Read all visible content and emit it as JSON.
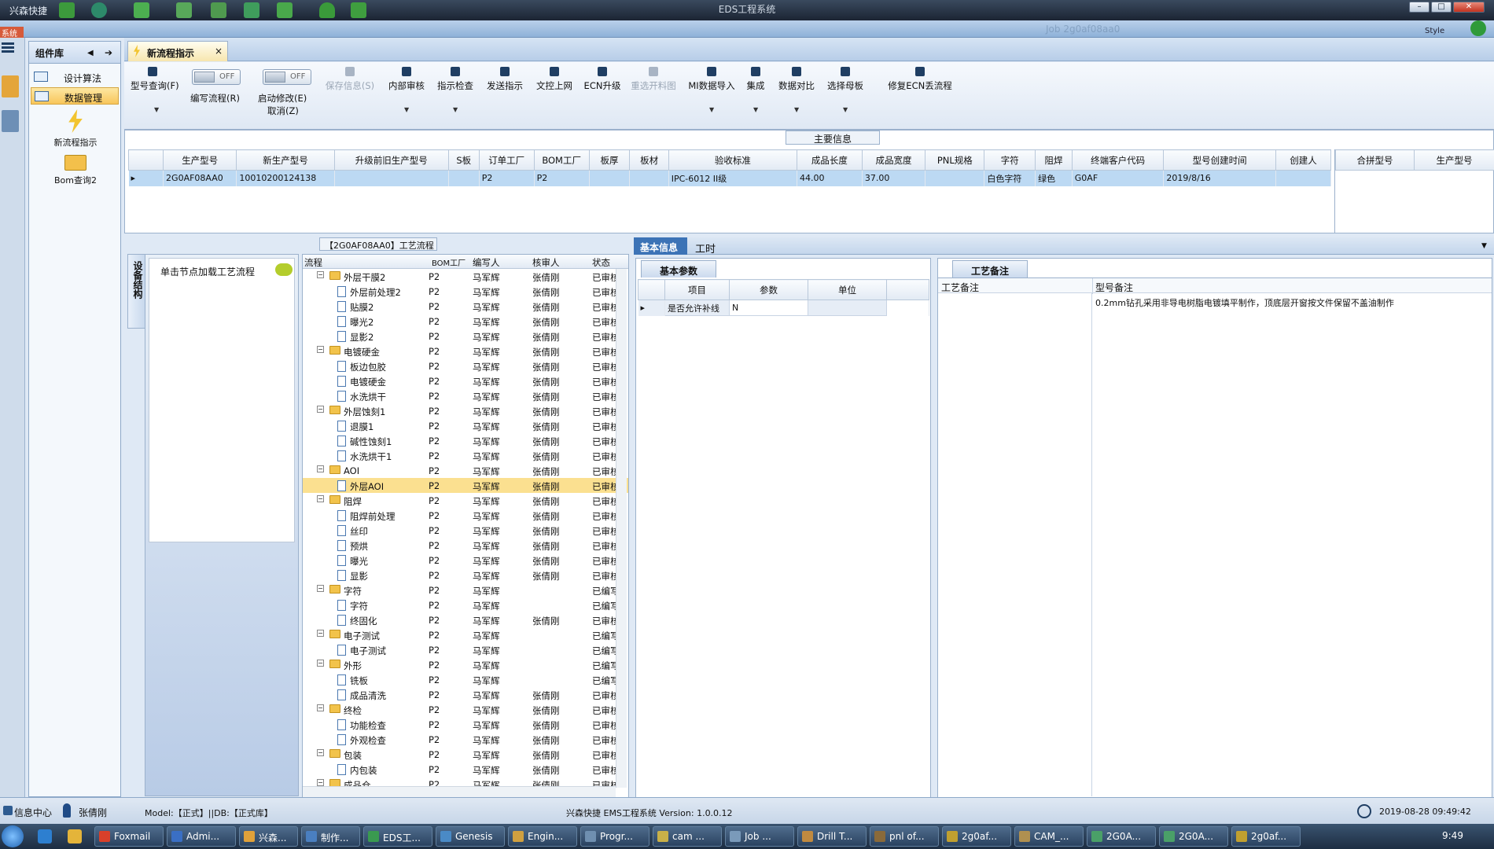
{
  "app": {
    "name": "兴森快捷",
    "window_title": "EDS工程系统",
    "sub_left": "系统",
    "sub_job": "Job  2g0af08aa0",
    "style_label": "Style"
  },
  "sidebar": {
    "title": "组件库",
    "items": [
      {
        "label": "设计算法"
      },
      {
        "label": "数据管理"
      }
    ],
    "tools": [
      {
        "label": "新流程指示"
      },
      {
        "label": "Bom查询2"
      }
    ]
  },
  "tab": {
    "label": "新流程指示"
  },
  "toolbar": {
    "buttons": [
      {
        "label": "型号查询(F)"
      },
      {
        "label": "编写流程(R)"
      },
      {
        "label": "启动修改(E)"
      },
      {
        "label": "取消(Z)"
      },
      {
        "label": "保存信息(S)"
      },
      {
        "label": "内部审核"
      },
      {
        "label": "指示检查"
      },
      {
        "label": "发送指示"
      },
      {
        "label": "文控上网"
      },
      {
        "label": "ECN升级"
      },
      {
        "label": "重选开料图"
      },
      {
        "label": "MI数据导入"
      },
      {
        "label": "集成"
      },
      {
        "label": "数据对比"
      },
      {
        "label": "选择母板"
      },
      {
        "label": "修复ECN丢流程"
      }
    ],
    "toggle_off": "OFF"
  },
  "main_info": {
    "caption": "主要信息",
    "columns": [
      "生产型号",
      "新生产型号",
      "升级前旧生产型号",
      "S板",
      "订单工厂",
      "BOM工厂",
      "板厚",
      "板材",
      "验收标准",
      "成品长度",
      "成品宽度",
      "PNL规格",
      "字符",
      "阻焊",
      "终端客户代码",
      "型号创建时间",
      "创建人"
    ],
    "row": [
      "2G0AF08AA0",
      "10010200124138",
      "",
      "",
      "P2",
      "P2",
      "",
      "",
      "IPC-6012 II级",
      "44.00",
      "37.00",
      "",
      "白色字符",
      "绿色",
      "G0AF",
      "2019/8/16",
      ""
    ],
    "side_columns": [
      "合拼型号",
      "生产型号"
    ]
  },
  "flow": {
    "caption": "【2G0AF08AA0】工艺流程",
    "struct_tab": "设备结构",
    "load_hint": "单击节点加载工艺流程",
    "columns": [
      "流程",
      "BOM工厂",
      "编写人",
      "核审人",
      "状态"
    ],
    "rows": [
      {
        "name": "外层干膜2",
        "level": 0,
        "bom": "P2",
        "author": "马军辉",
        "reviewer": "张倩刚",
        "status": "已审核"
      },
      {
        "name": "外层前处理2",
        "level": 1,
        "bom": "P2",
        "author": "马军辉",
        "reviewer": "张倩刚",
        "status": "已审核"
      },
      {
        "name": "贴膜2",
        "level": 1,
        "bom": "P2",
        "author": "马军辉",
        "reviewer": "张倩刚",
        "status": "已审核"
      },
      {
        "name": "曝光2",
        "level": 1,
        "bom": "P2",
        "author": "马军辉",
        "reviewer": "张倩刚",
        "status": "已审核"
      },
      {
        "name": "显影2",
        "level": 1,
        "bom": "P2",
        "author": "马军辉",
        "reviewer": "张倩刚",
        "status": "已审核"
      },
      {
        "name": "电镀硬金",
        "level": 0,
        "bom": "P2",
        "author": "马军辉",
        "reviewer": "张倩刚",
        "status": "已审核"
      },
      {
        "name": "板边包胶",
        "level": 1,
        "bom": "P2",
        "author": "马军辉",
        "reviewer": "张倩刚",
        "status": "已审核"
      },
      {
        "name": "电镀硬金",
        "level": 1,
        "bom": "P2",
        "author": "马军辉",
        "reviewer": "张倩刚",
        "status": "已审核"
      },
      {
        "name": "水洗烘干",
        "level": 1,
        "bom": "P2",
        "author": "马军辉",
        "reviewer": "张倩刚",
        "status": "已审核"
      },
      {
        "name": "外层蚀刻1",
        "level": 0,
        "bom": "P2",
        "author": "马军辉",
        "reviewer": "张倩刚",
        "status": "已审核"
      },
      {
        "name": "退膜1",
        "level": 1,
        "bom": "P2",
        "author": "马军辉",
        "reviewer": "张倩刚",
        "status": "已审核"
      },
      {
        "name": "碱性蚀刻1",
        "level": 1,
        "bom": "P2",
        "author": "马军辉",
        "reviewer": "张倩刚",
        "status": "已审核"
      },
      {
        "name": "水洗烘干1",
        "level": 1,
        "bom": "P2",
        "author": "马军辉",
        "reviewer": "张倩刚",
        "status": "已审核"
      },
      {
        "name": "AOI",
        "level": 0,
        "bom": "P2",
        "author": "马军辉",
        "reviewer": "张倩刚",
        "status": "已审核"
      },
      {
        "name": "外层AOI",
        "level": 1,
        "bom": "P2",
        "author": "马军辉",
        "reviewer": "张倩刚",
        "status": "已审核",
        "selected": true
      },
      {
        "name": "阻焊",
        "level": 0,
        "bom": "P2",
        "author": "马军辉",
        "reviewer": "张倩刚",
        "status": "已审核"
      },
      {
        "name": "阻焊前处理",
        "level": 1,
        "bom": "P2",
        "author": "马军辉",
        "reviewer": "张倩刚",
        "status": "已审核"
      },
      {
        "name": "丝印",
        "level": 1,
        "bom": "P2",
        "author": "马军辉",
        "reviewer": "张倩刚",
        "status": "已审核"
      },
      {
        "name": "预烘",
        "level": 1,
        "bom": "P2",
        "author": "马军辉",
        "reviewer": "张倩刚",
        "status": "已审核"
      },
      {
        "name": "曝光",
        "level": 1,
        "bom": "P2",
        "author": "马军辉",
        "reviewer": "张倩刚",
        "status": "已审核"
      },
      {
        "name": "显影",
        "level": 1,
        "bom": "P2",
        "author": "马军辉",
        "reviewer": "张倩刚",
        "status": "已审核"
      },
      {
        "name": "字符",
        "level": 0,
        "bom": "P2",
        "author": "马军辉",
        "reviewer": "",
        "status": "已编写"
      },
      {
        "name": "字符",
        "level": 1,
        "bom": "P2",
        "author": "马军辉",
        "reviewer": "",
        "status": "已编写"
      },
      {
        "name": "终固化",
        "level": 1,
        "bom": "P2",
        "author": "马军辉",
        "reviewer": "张倩刚",
        "status": "已审核"
      },
      {
        "name": "电子测试",
        "level": 0,
        "bom": "P2",
        "author": "马军辉",
        "reviewer": "",
        "status": "已编写"
      },
      {
        "name": "电子测试",
        "level": 1,
        "bom": "P2",
        "author": "马军辉",
        "reviewer": "",
        "status": "已编写"
      },
      {
        "name": "外形",
        "level": 0,
        "bom": "P2",
        "author": "马军辉",
        "reviewer": "",
        "status": "已编写"
      },
      {
        "name": "铣板",
        "level": 1,
        "bom": "P2",
        "author": "马军辉",
        "reviewer": "",
        "status": "已编写"
      },
      {
        "name": "成品清洗",
        "level": 1,
        "bom": "P2",
        "author": "马军辉",
        "reviewer": "张倩刚",
        "status": "已审核"
      },
      {
        "name": "终检",
        "level": 0,
        "bom": "P2",
        "author": "马军辉",
        "reviewer": "张倩刚",
        "status": "已审核"
      },
      {
        "name": "功能检查",
        "level": 1,
        "bom": "P2",
        "author": "马军辉",
        "reviewer": "张倩刚",
        "status": "已审核"
      },
      {
        "name": "外观检查",
        "level": 1,
        "bom": "P2",
        "author": "马军辉",
        "reviewer": "张倩刚",
        "status": "已审核"
      },
      {
        "name": "包装",
        "level": 0,
        "bom": "P2",
        "author": "马军辉",
        "reviewer": "张倩刚",
        "status": "已审核"
      },
      {
        "name": "内包装",
        "level": 1,
        "bom": "P2",
        "author": "马军辉",
        "reviewer": "张倩刚",
        "status": "已审核"
      },
      {
        "name": "成品仓",
        "level": 0,
        "bom": "P2",
        "author": "马军辉",
        "reviewer": "张倩刚",
        "status": "已审核"
      }
    ]
  },
  "right": {
    "tabs": [
      "基本信息",
      "工时"
    ],
    "basic": {
      "subtab": "基本参数",
      "columns": [
        "项目",
        "参数",
        "单位"
      ],
      "row": [
        "是否允许补线",
        "N",
        ""
      ]
    },
    "notes": {
      "subtab": "工艺备注",
      "columns": [
        "工艺备注",
        "型号备注"
      ],
      "model_note": "0.2mm钻孔采用非导电树脂电镀填平制作，顶底层开窗按文件保留不盖油制作"
    }
  },
  "status": {
    "info_center": "信息中心",
    "user": "张倩刚",
    "model_db": "Model:【正式】||DB:【正式库】",
    "version": "兴森快捷 EMS工程系统 Version: 1.0.0.12",
    "datetime": "2019-08-28 09:49:42"
  },
  "taskbar": {
    "clock": "9:49",
    "tasks": [
      "Foxmail",
      "Admi...",
      "兴森...",
      "制作...",
      "EDS工...",
      "Genesis",
      "Engin...",
      "Progr...",
      "cam ...",
      "Job ...",
      "Drill T...",
      "pnl of...",
      "2g0af...",
      "CAM_...",
      "2G0A...",
      "2G0A...",
      "2g0af..."
    ]
  }
}
